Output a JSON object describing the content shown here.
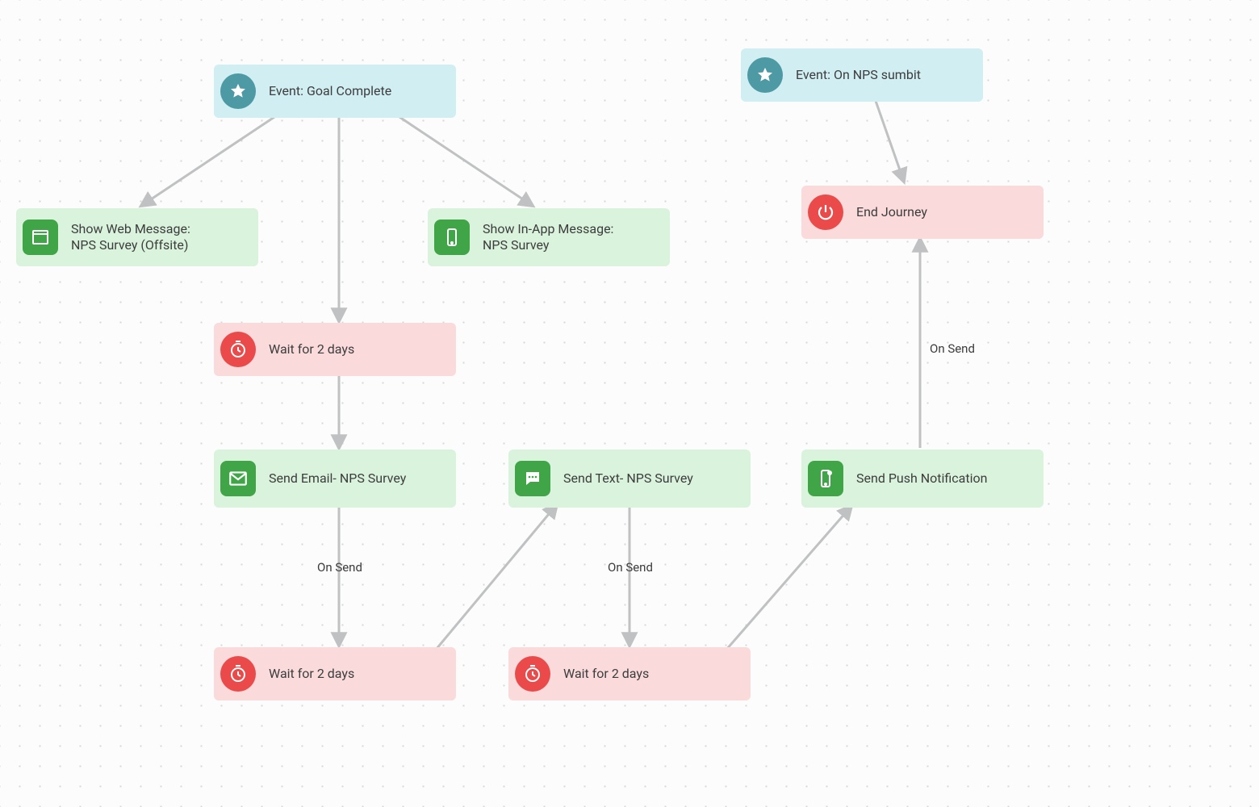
{
  "nodes": {
    "event_goal": {
      "label": "Event: Goal Complete"
    },
    "event_nps": {
      "label": "Event: On NPS sumbit"
    },
    "show_web": {
      "label_l1": "Show Web Message:",
      "label_l2": "NPS Survey (Offsite)"
    },
    "show_inapp": {
      "label_l1": "Show In-App Message:",
      "label_l2": "NPS Survey"
    },
    "wait1": {
      "label": "Wait for 2 days"
    },
    "send_email": {
      "label": "Send Email- NPS Survey"
    },
    "send_text": {
      "label": "Send Text- NPS Survey"
    },
    "send_push": {
      "label": "Send Push Notification"
    },
    "wait2": {
      "label": "Wait for 2 days"
    },
    "wait3": {
      "label": "Wait for 2 days"
    },
    "end": {
      "label": "End Journey"
    }
  },
  "edge_labels": {
    "on_send_1": "On Send",
    "on_send_2": "On Send",
    "on_send_3": "On Send"
  },
  "colors": {
    "event_bg": "#d1eef2",
    "event_icon": "#4d9aa4",
    "action_bg": "#d9f3dc",
    "action_icon": "#3fa546",
    "wait_bg": "#fadadb",
    "wait_icon": "#ea4a49",
    "arrow": "#bfc1c2"
  }
}
